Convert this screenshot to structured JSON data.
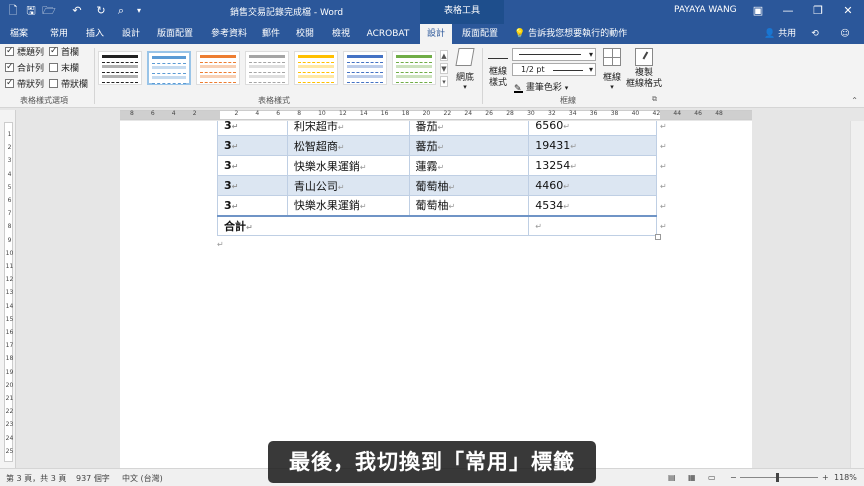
{
  "window": {
    "title": "銷售交易記錄完成檔 - Word",
    "context_tab_header": "表格工具",
    "user": "PAYAYA WANG",
    "minimize": "—",
    "restore": "❐",
    "close": "✕"
  },
  "quick_access": [
    "new-doc-icon",
    "save-icon",
    "open-icon",
    "undo-icon",
    "redo-icon",
    "print-preview-icon"
  ],
  "tabs": [
    {
      "label": "檔案",
      "active": false
    },
    {
      "label": "常用",
      "active": false
    },
    {
      "label": "插入",
      "active": false
    },
    {
      "label": "設計",
      "active": false
    },
    {
      "label": "版面配置",
      "active": false
    },
    {
      "label": "參考資料",
      "active": false
    },
    {
      "label": "郵件",
      "active": false
    },
    {
      "label": "校閱",
      "active": false
    },
    {
      "label": "檢視",
      "active": false
    },
    {
      "label": "ACROBAT",
      "active": false
    },
    {
      "label": "設計",
      "active": true
    },
    {
      "label": "版面配置",
      "active": false
    }
  ],
  "tell_me": "告訴我您想要執行的動作",
  "share": "共用",
  "ribbon": {
    "style_options": {
      "items": [
        {
          "label": "標題列",
          "checked": true
        },
        {
          "label": "首欄",
          "checked": true
        },
        {
          "label": "合計列",
          "checked": true
        },
        {
          "label": "末欄",
          "checked": false
        },
        {
          "label": "帶狀列",
          "checked": true
        },
        {
          "label": "帶狀欄",
          "checked": false
        }
      ],
      "group_label": "表格樣式選項"
    },
    "table_styles": {
      "group_label": "表格樣式",
      "thumb_colors": [
        "#222222",
        "#5b9bd5",
        "#ed7d31",
        "#a5a5a5",
        "#ffc000",
        "#4472c4",
        "#70ad47"
      ]
    },
    "shading": {
      "label": "網底"
    },
    "borders": {
      "border_styles_label": "框線\n樣式",
      "pen_weight": "1/2 pt",
      "pen_color": "畫筆色彩",
      "borders_label": "框線",
      "painter_label": "複製\n框線格式",
      "group_label": "框線"
    }
  },
  "ruler": {
    "h_numbers": [
      "8",
      "6",
      "4",
      "2",
      "",
      "2",
      "4",
      "6",
      "8",
      "10",
      "12",
      "14",
      "16",
      "18",
      "20",
      "22",
      "24",
      "26",
      "28",
      "30",
      "32",
      "34",
      "36",
      "38",
      "40",
      "42",
      "44",
      "46",
      "48"
    ],
    "v_numbers": [
      "1",
      "2",
      "3",
      "4",
      "5",
      "6",
      "7",
      "8",
      "9",
      "10",
      "11",
      "12",
      "13",
      "14",
      "15",
      "16",
      "17",
      "18",
      "19",
      "20",
      "21",
      "22",
      "23",
      "24",
      "25"
    ],
    "corner": "L"
  },
  "table": {
    "rows": [
      {
        "c1": "3",
        "c2": "利宋超市",
        "c3": "番茄",
        "c4": "6560",
        "band": false
      },
      {
        "c1": "3",
        "c2": "松智超商",
        "c3": "蕃茄",
        "c4": "19431",
        "band": true
      },
      {
        "c1": "3",
        "c2": "快樂水果運銷",
        "c3": "蓮霧",
        "c4": "13254",
        "band": false
      },
      {
        "c1": "3",
        "c2": "青山公司",
        "c3": "葡萄柚",
        "c4": "4460",
        "band": true
      },
      {
        "c1": "3",
        "c2": "快樂水果運銷",
        "c3": "葡萄柚",
        "c4": "4534",
        "band": false
      }
    ],
    "total_label": "合計",
    "para_mark": "↵"
  },
  "status": {
    "page": "第 3 頁，共 3 頁",
    "words": "937 個字",
    "language": "中文 (台灣)",
    "zoom": "118%",
    "zoom_minus": "−",
    "zoom_plus": "+"
  },
  "caption": "最後，我切換到「常用」標籤"
}
